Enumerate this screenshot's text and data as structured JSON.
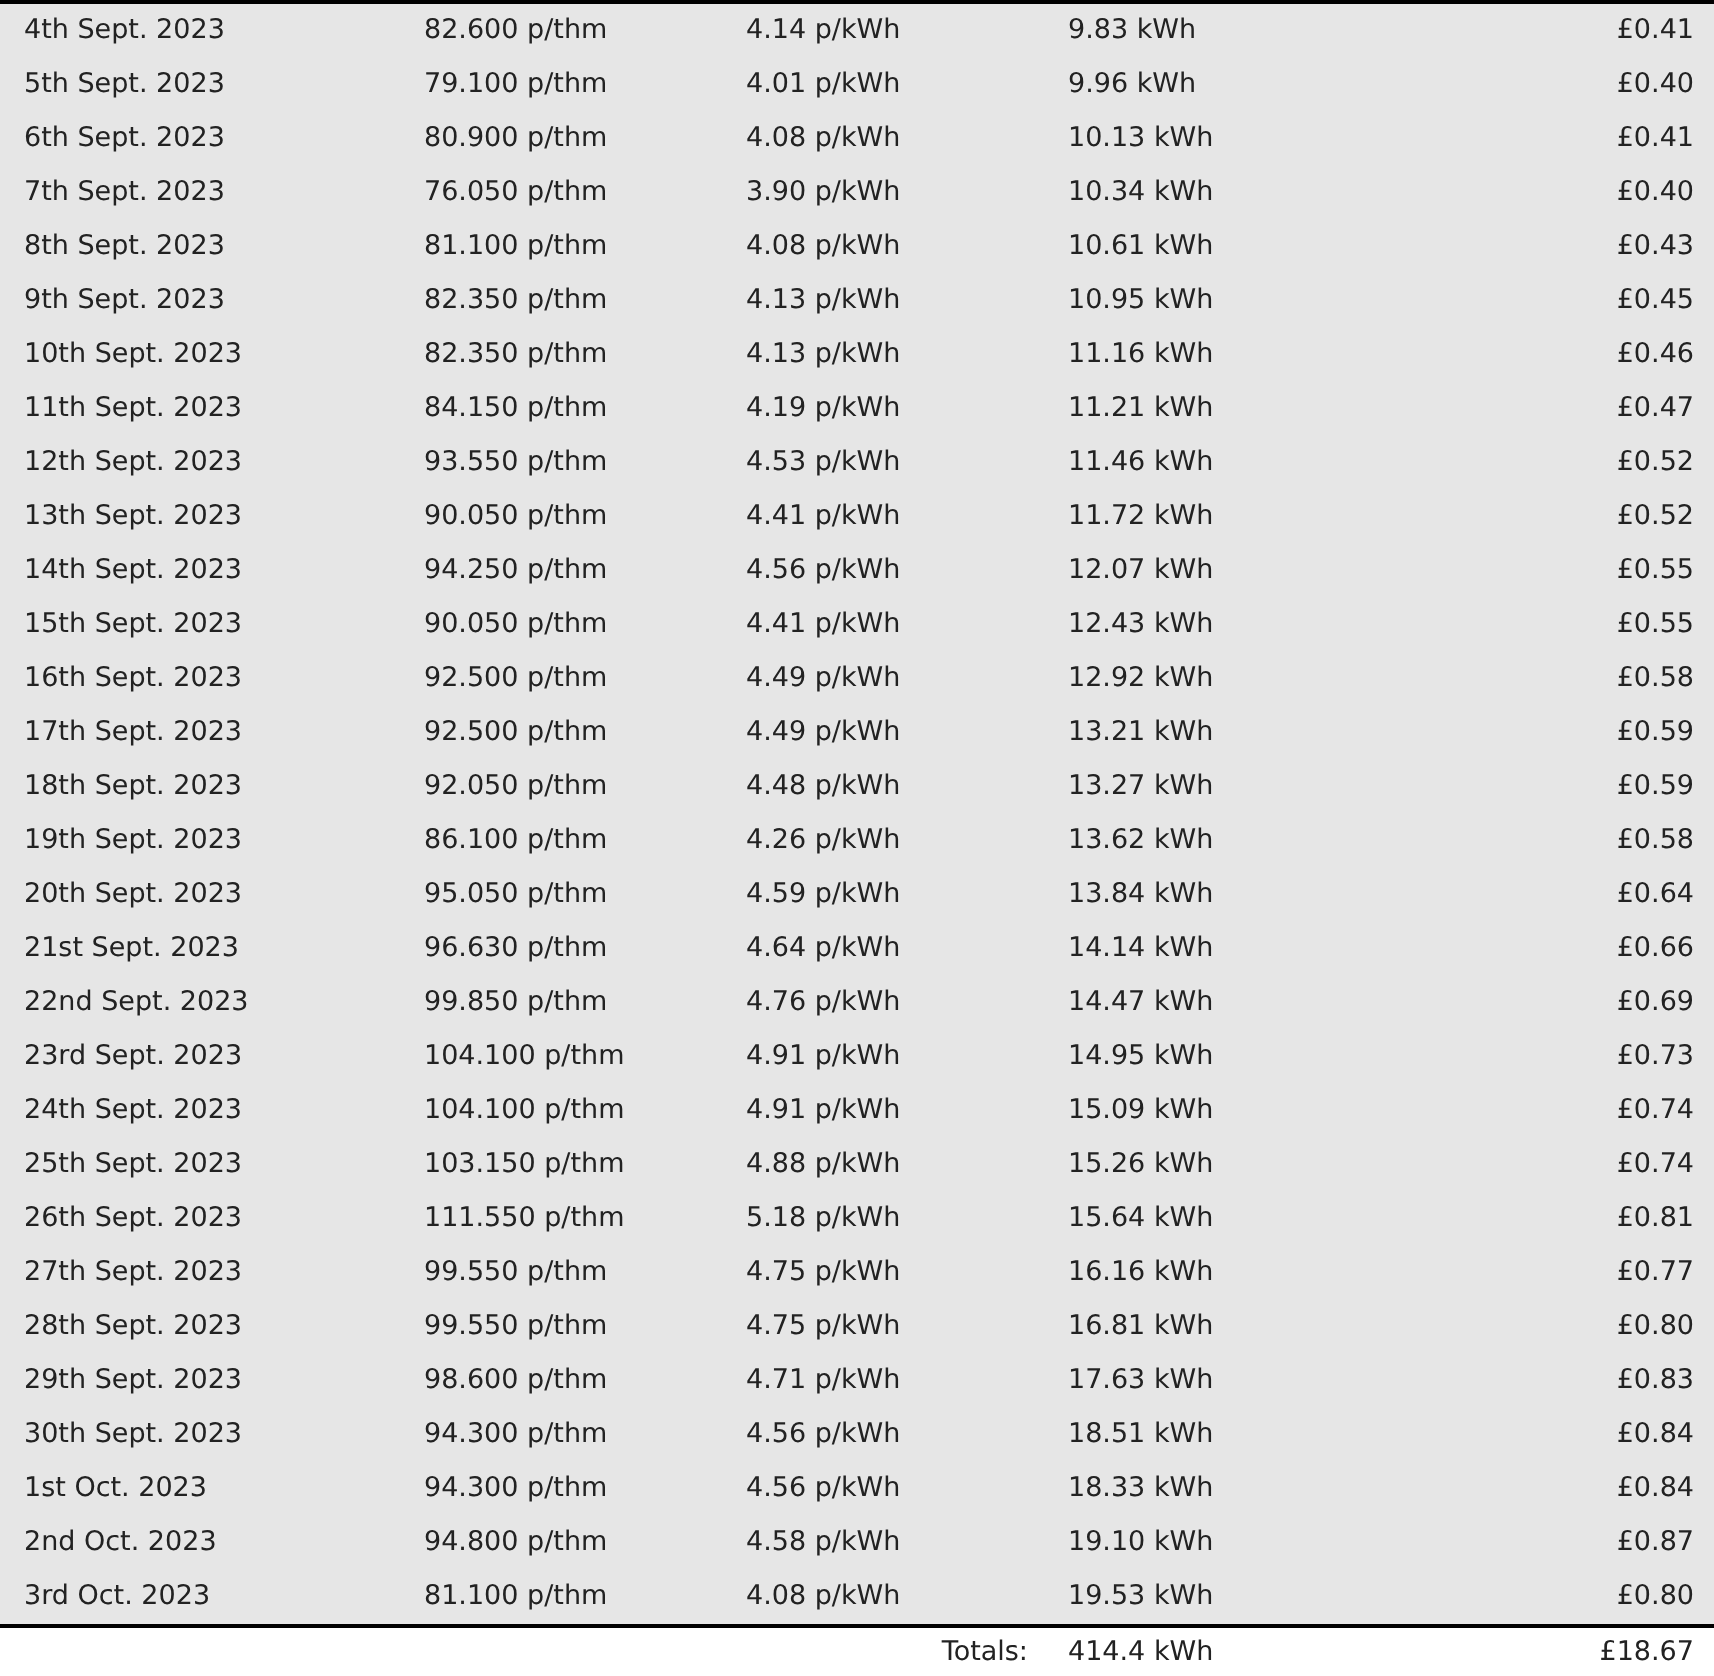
{
  "rows": [
    [
      "4th Sept. 2023",
      "82.600 p/thm",
      "4.14 p/kWh",
      "9.83 kWh",
      "£0.41"
    ],
    [
      "5th Sept. 2023",
      "79.100 p/thm",
      "4.01 p/kWh",
      "9.96 kWh",
      "£0.40"
    ],
    [
      "6th Sept. 2023",
      "80.900 p/thm",
      "4.08 p/kWh",
      "10.13 kWh",
      "£0.41"
    ],
    [
      "7th Sept. 2023",
      "76.050 p/thm",
      "3.90 p/kWh",
      "10.34 kWh",
      "£0.40"
    ],
    [
      "8th Sept. 2023",
      "81.100 p/thm",
      "4.08 p/kWh",
      "10.61 kWh",
      "£0.43"
    ],
    [
      "9th Sept. 2023",
      "82.350 p/thm",
      "4.13 p/kWh",
      "10.95 kWh",
      "£0.45"
    ],
    [
      "10th Sept. 2023",
      "82.350 p/thm",
      "4.13 p/kWh",
      "11.16 kWh",
      "£0.46"
    ],
    [
      "11th Sept. 2023",
      "84.150 p/thm",
      "4.19 p/kWh",
      "11.21 kWh",
      "£0.47"
    ],
    [
      "12th Sept. 2023",
      "93.550 p/thm",
      "4.53 p/kWh",
      "11.46 kWh",
      "£0.52"
    ],
    [
      "13th Sept. 2023",
      "90.050 p/thm",
      "4.41 p/kWh",
      "11.72 kWh",
      "£0.52"
    ],
    [
      "14th Sept. 2023",
      "94.250 p/thm",
      "4.56 p/kWh",
      "12.07 kWh",
      "£0.55"
    ],
    [
      "15th Sept. 2023",
      "90.050 p/thm",
      "4.41 p/kWh",
      "12.43 kWh",
      "£0.55"
    ],
    [
      "16th Sept. 2023",
      "92.500 p/thm",
      "4.49 p/kWh",
      "12.92 kWh",
      "£0.58"
    ],
    [
      "17th Sept. 2023",
      "92.500 p/thm",
      "4.49 p/kWh",
      "13.21 kWh",
      "£0.59"
    ],
    [
      "18th Sept. 2023",
      "92.050 p/thm",
      "4.48 p/kWh",
      "13.27 kWh",
      "£0.59"
    ],
    [
      "19th Sept. 2023",
      "86.100 p/thm",
      "4.26 p/kWh",
      "13.62 kWh",
      "£0.58"
    ],
    [
      "20th Sept. 2023",
      "95.050 p/thm",
      "4.59 p/kWh",
      "13.84 kWh",
      "£0.64"
    ],
    [
      "21st Sept. 2023",
      "96.630 p/thm",
      "4.64 p/kWh",
      "14.14 kWh",
      "£0.66"
    ],
    [
      "22nd Sept. 2023",
      "99.850 p/thm",
      "4.76 p/kWh",
      "14.47 kWh",
      "£0.69"
    ],
    [
      "23rd Sept. 2023",
      "104.100 p/thm",
      "4.91 p/kWh",
      "14.95 kWh",
      "£0.73"
    ],
    [
      "24th Sept. 2023",
      "104.100 p/thm",
      "4.91 p/kWh",
      "15.09 kWh",
      "£0.74"
    ],
    [
      "25th Sept. 2023",
      "103.150 p/thm",
      "4.88 p/kWh",
      "15.26 kWh",
      "£0.74"
    ],
    [
      "26th Sept. 2023",
      "111.550 p/thm",
      "5.18 p/kWh",
      "15.64 kWh",
      "£0.81"
    ],
    [
      "27th Sept. 2023",
      "99.550 p/thm",
      "4.75 p/kWh",
      "16.16 kWh",
      "£0.77"
    ],
    [
      "28th Sept. 2023",
      "99.550 p/thm",
      "4.75 p/kWh",
      "16.81 kWh",
      "£0.80"
    ],
    [
      "29th Sept. 2023",
      "98.600 p/thm",
      "4.71 p/kWh",
      "17.63 kWh",
      "£0.83"
    ],
    [
      "30th Sept. 2023",
      "94.300 p/thm",
      "4.56 p/kWh",
      "18.51 kWh",
      "£0.84"
    ],
    [
      "1st Oct. 2023",
      "94.300 p/thm",
      "4.56 p/kWh",
      "18.33 kWh",
      "£0.84"
    ],
    [
      "2nd Oct. 2023",
      "94.800 p/thm",
      "4.58 p/kWh",
      "19.10 kWh",
      "£0.87"
    ],
    [
      "3rd Oct. 2023",
      "81.100 p/thm",
      "4.08 p/kWh",
      "19.53 kWh",
      "£0.80"
    ]
  ],
  "totals": {
    "label": "Totals:",
    "energy": "414.4 kWh",
    "cost": "£18.67"
  }
}
